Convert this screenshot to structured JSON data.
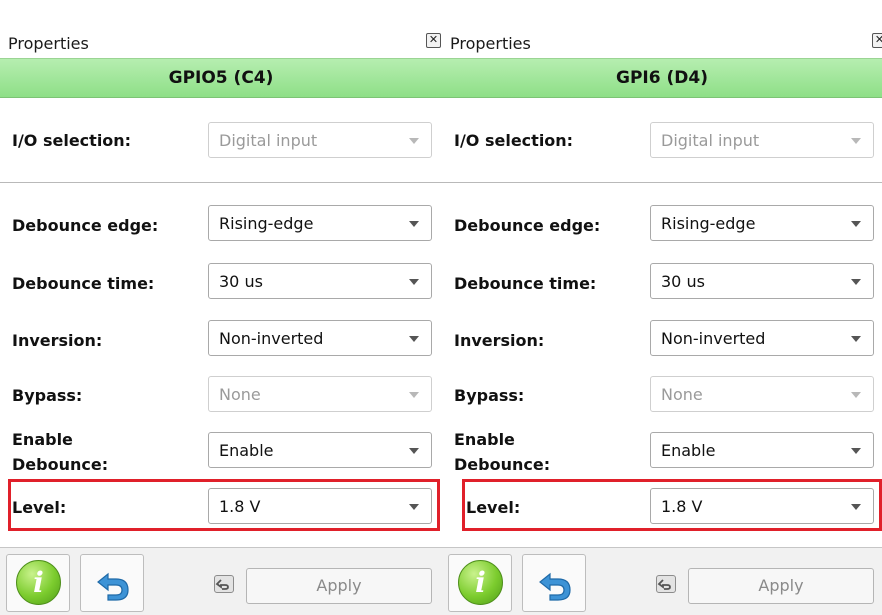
{
  "colors": {
    "title_bar_green": "#9be693",
    "highlight_red": "#e0202a",
    "disabled_text": "#9a9a9a"
  },
  "panels": [
    {
      "header": "Properties",
      "title": "GPIO5 (C4)",
      "io_selection": {
        "label": "I/O selection:",
        "value": "Digital input",
        "disabled": true
      },
      "debounce_edge": {
        "label": "Debounce edge:",
        "value": "Rising-edge"
      },
      "debounce_time": {
        "label": "Debounce time:",
        "value": "30 us"
      },
      "inversion": {
        "label": "Inversion:",
        "value": "Non-inverted"
      },
      "bypass": {
        "label": "Bypass:",
        "value": "None",
        "disabled": true
      },
      "enable_debounce": {
        "label_line1": "Enable",
        "label_line2": "Debounce:",
        "value": "Enable"
      },
      "level": {
        "label": "Level:",
        "value": "1.8 V",
        "highlighted": true
      },
      "footer": {
        "info_icon": "info-icon",
        "undo_icon": "undo-arrow-icon",
        "apply_label": "Apply"
      }
    },
    {
      "header": "Properties",
      "title": "GPI6 (D4)",
      "io_selection": {
        "label": "I/O selection:",
        "value": "Digital input",
        "disabled": true
      },
      "debounce_edge": {
        "label": "Debounce edge:",
        "value": "Rising-edge"
      },
      "debounce_time": {
        "label": "Debounce time:",
        "value": "30 us"
      },
      "inversion": {
        "label": "Inversion:",
        "value": "Non-inverted"
      },
      "bypass": {
        "label": "Bypass:",
        "value": "None",
        "disabled": true
      },
      "enable_debounce": {
        "label_line1": "Enable",
        "label_line2": "Debounce:",
        "value": "Enable"
      },
      "level": {
        "label": "Level:",
        "value": "1.8 V",
        "highlighted": true
      },
      "footer": {
        "info_icon": "info-icon",
        "undo_icon": "undo-arrow-icon",
        "apply_label": "Apply"
      }
    }
  ]
}
